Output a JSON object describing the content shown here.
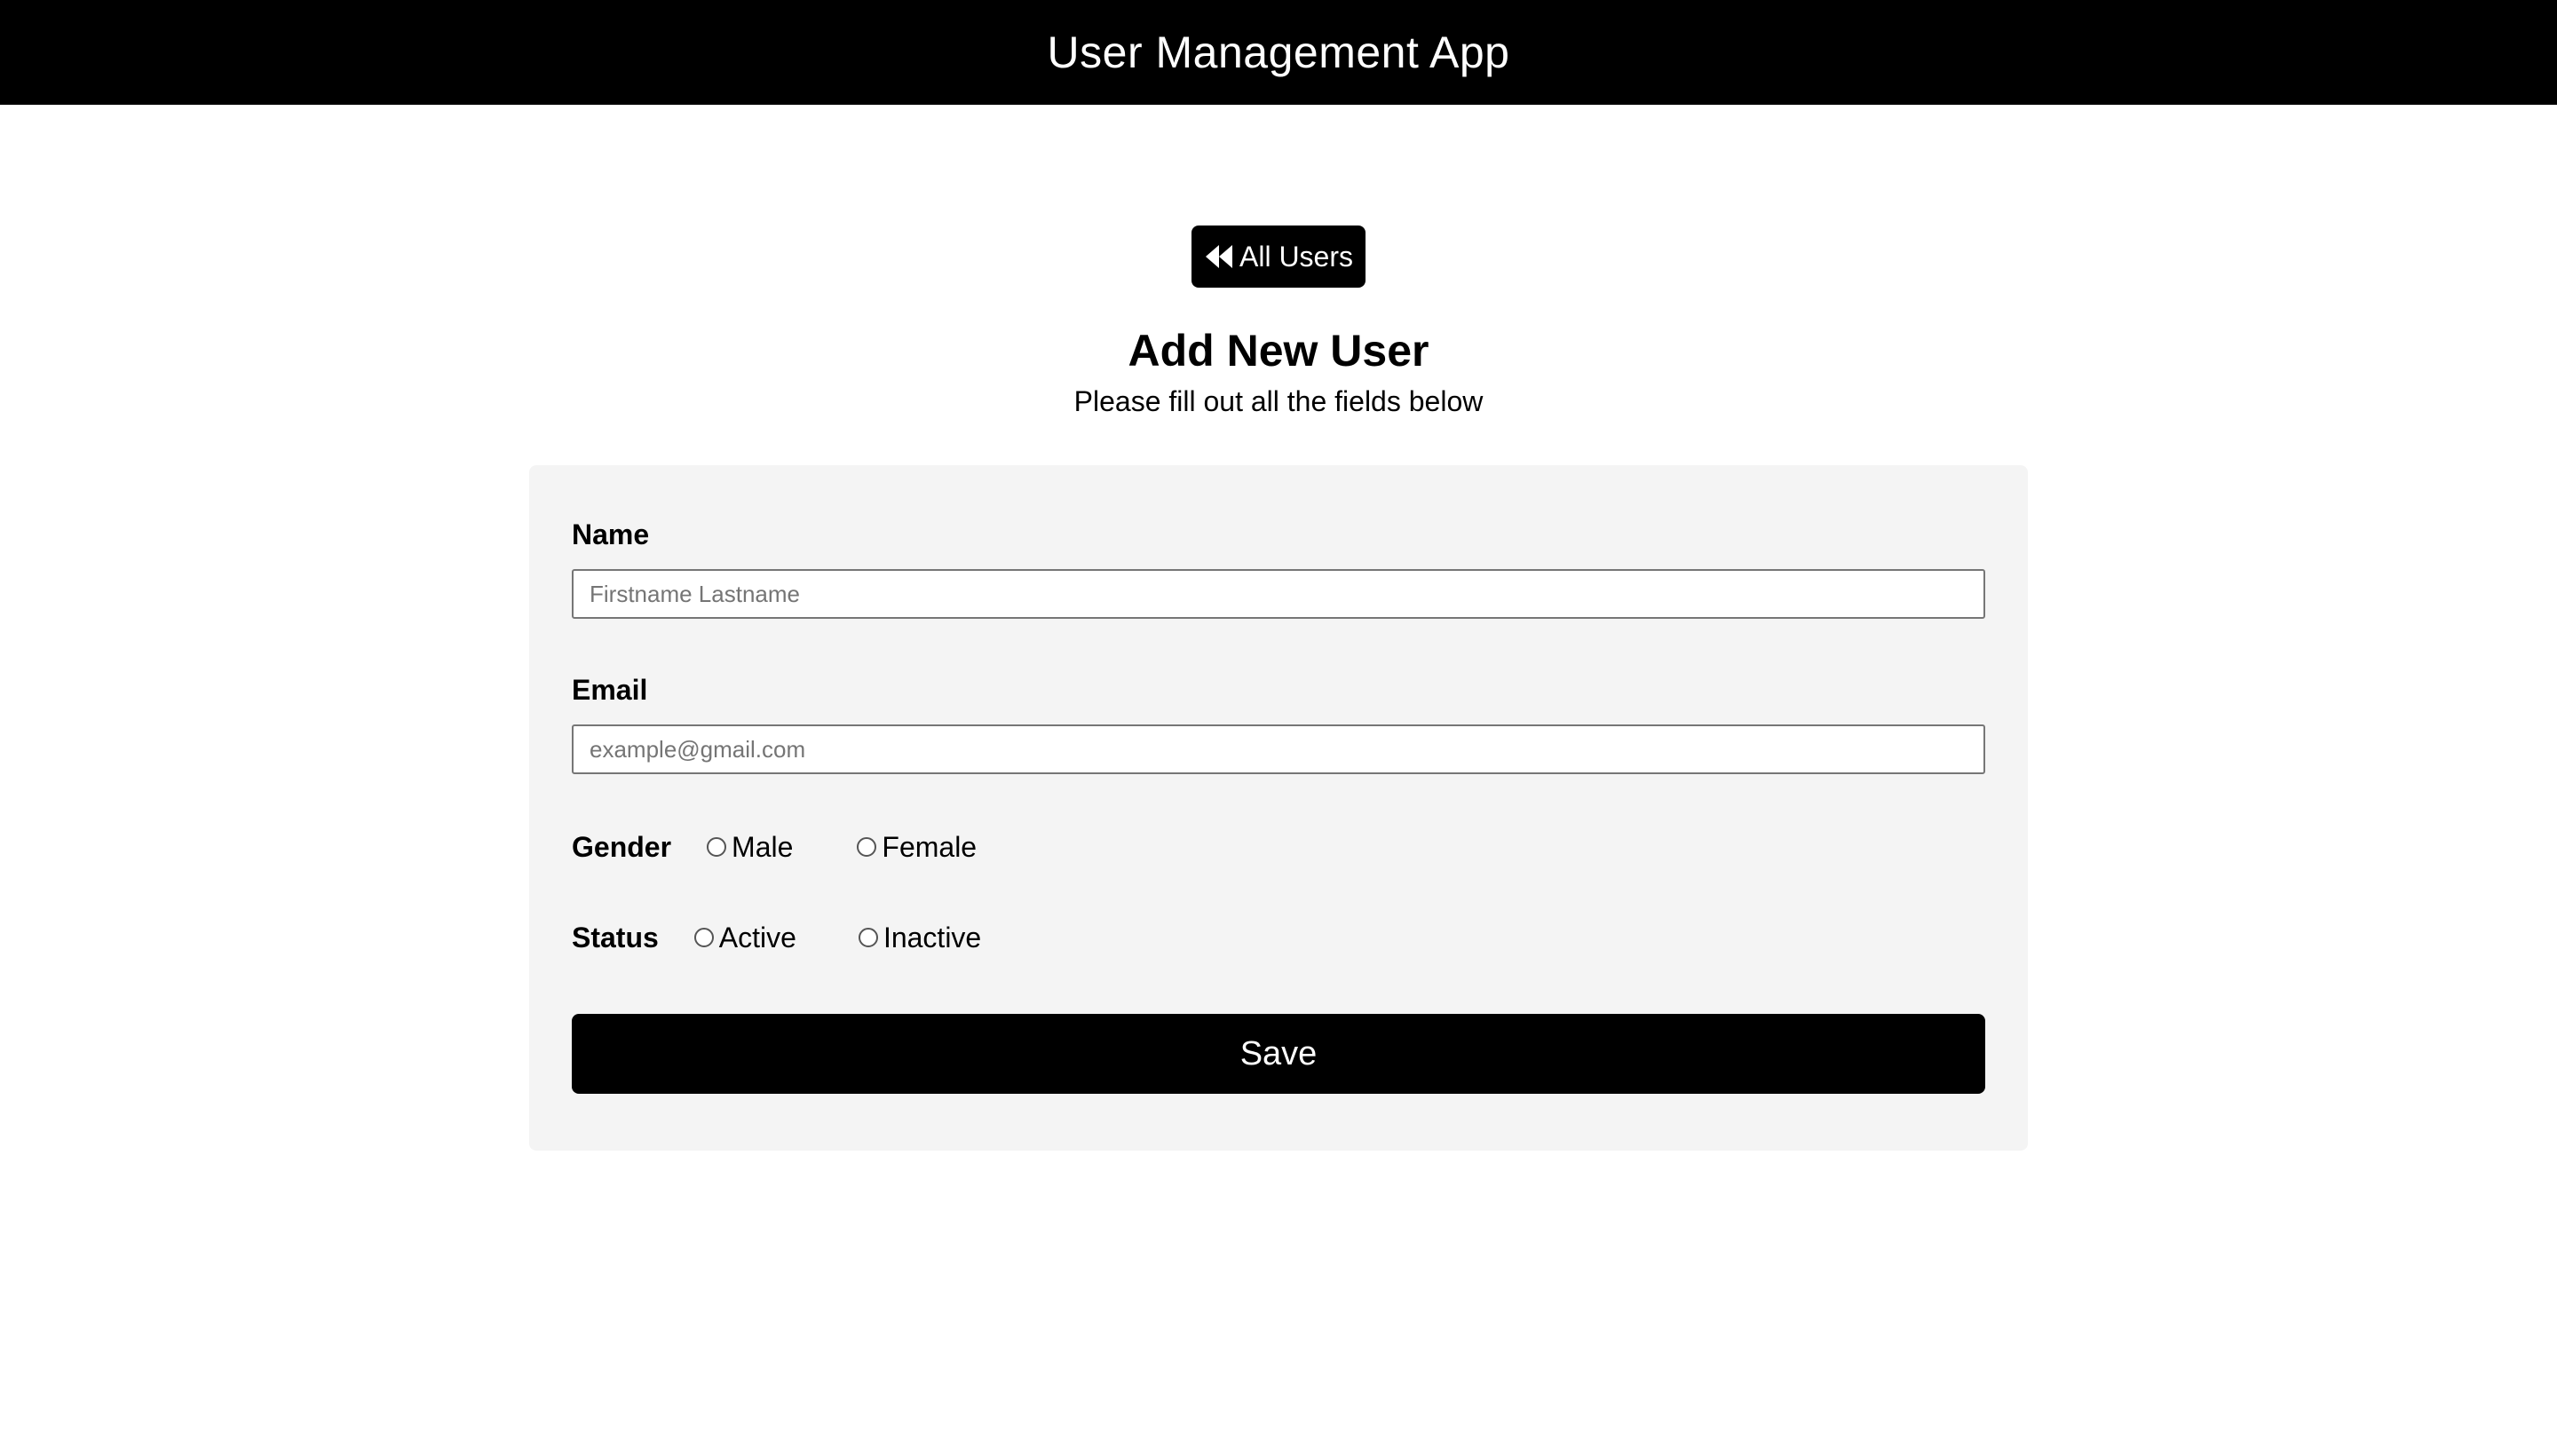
{
  "header": {
    "title": "User Management App"
  },
  "back_button": {
    "label": "All Users",
    "icon": "backward-icon"
  },
  "page": {
    "title": "Add New User",
    "subtitle": "Please fill out all the fields below"
  },
  "form": {
    "name": {
      "label": "Name",
      "value": "",
      "placeholder": "Firstname Lastname"
    },
    "email": {
      "label": "Email",
      "value": "",
      "placeholder": "example@gmail.com"
    },
    "gender": {
      "label": "Gender",
      "options": [
        "Male",
        "Female"
      ],
      "selected": null
    },
    "status": {
      "label": "Status",
      "options": [
        "Active",
        "Inactive"
      ],
      "selected": null
    },
    "save_label": "Save"
  },
  "colors": {
    "header_bg": "#000000",
    "card_bg": "#f4f4f4",
    "button_bg": "#000000",
    "button_text": "#ffffff"
  }
}
